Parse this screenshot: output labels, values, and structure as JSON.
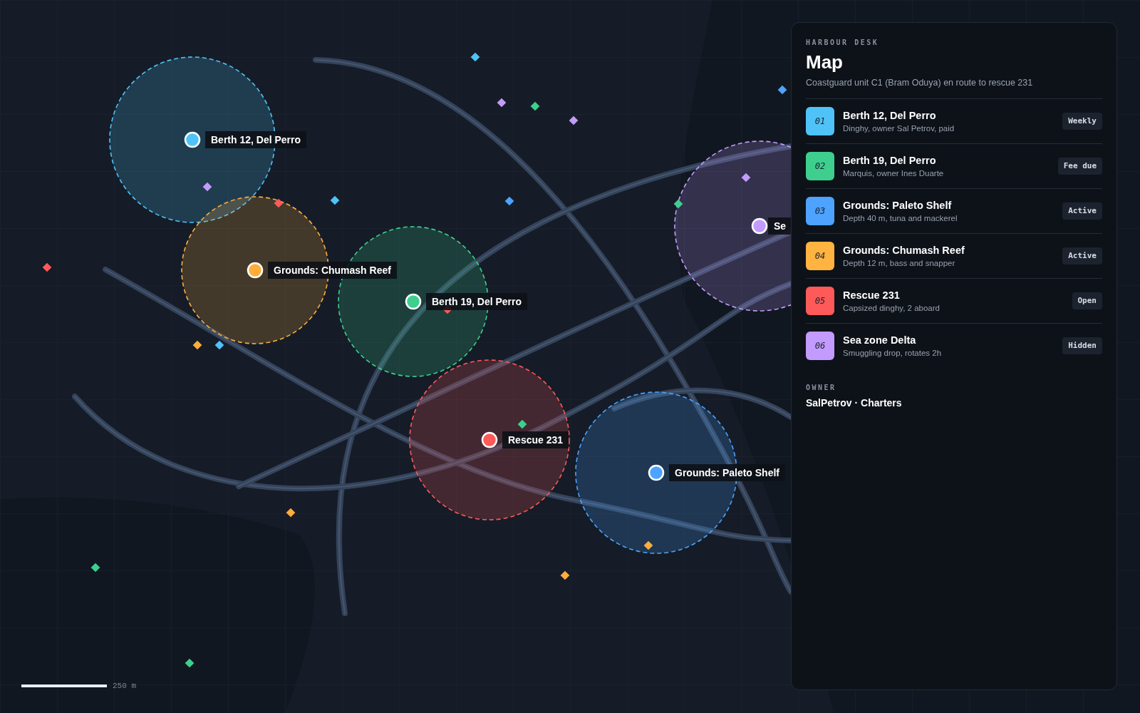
{
  "map": {
    "pins": [
      {
        "label": "Berth 12, Del Perro",
        "color": "#4fc3f7"
      },
      {
        "label": "Grounds: Chumash Reef",
        "color": "#ffad3b"
      },
      {
        "label": "Berth 19, Del Perro",
        "color": "#3ecf8e"
      },
      {
        "label": "Rescue 231",
        "color": "#ff5a5a"
      },
      {
        "label": "Grounds: Paleto Shelf",
        "color": "#4da3ff"
      },
      {
        "label": "Se",
        "color": "#c39bff"
      }
    ],
    "scale": "250 m"
  },
  "panel": {
    "eyebrow": "HARBOUR DESK",
    "title": "Map",
    "subtitle": "Coastguard unit C1 (Bram Oduya) en route to rescue 231",
    "items": [
      {
        "index": "01",
        "title": "Berth 12, Del Perro",
        "detail": "Dinghy, owner Sal Petrov, paid",
        "tag": "Weekly",
        "color": "#4fc3f7"
      },
      {
        "index": "02",
        "title": "Berth 19, Del Perro",
        "detail": "Marquis, owner Ines Duarte",
        "tag": "Fee due",
        "color": "#3ecf8e"
      },
      {
        "index": "03",
        "title": "Grounds: Paleto Shelf",
        "detail": "Depth 40 m, tuna and mackerel",
        "tag": "Active",
        "color": "#4da3ff"
      },
      {
        "index": "04",
        "title": "Grounds: Chumash Reef",
        "detail": "Depth 12 m, bass and snapper",
        "tag": "Active",
        "color": "#ffb340"
      },
      {
        "index": "05",
        "title": "Rescue 231",
        "detail": "Capsized dinghy, 2 aboard",
        "tag": "Open",
        "color": "#ff5a5a"
      },
      {
        "index": "06",
        "title": "Sea zone Delta",
        "detail": "Smuggling drop, rotates 2h",
        "tag": "Hidden",
        "color": "#c39bff"
      }
    ],
    "owner_label": "OWNER",
    "owner": "SalPetrov · Charters"
  }
}
